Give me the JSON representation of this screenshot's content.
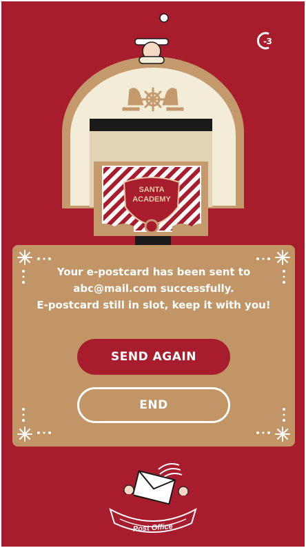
{
  "timer": {
    "value": "-3"
  },
  "postcard": {
    "badge_line1": "SANTA",
    "badge_line2": "ACADEMY"
  },
  "message": {
    "line1": "Your e-postcard has been sent to",
    "line2": "abc@mail.com successfully.",
    "line3": "E-postcard still in slot, keep it with you!"
  },
  "buttons": {
    "send_again": "SEND AGAIN",
    "end": "END"
  },
  "logo": {
    "label": "Post Office"
  },
  "colors": {
    "background": "#a81d2e",
    "panel": "#c19566",
    "cream": "#f3ecd8",
    "gold": "#c49a6c"
  }
}
